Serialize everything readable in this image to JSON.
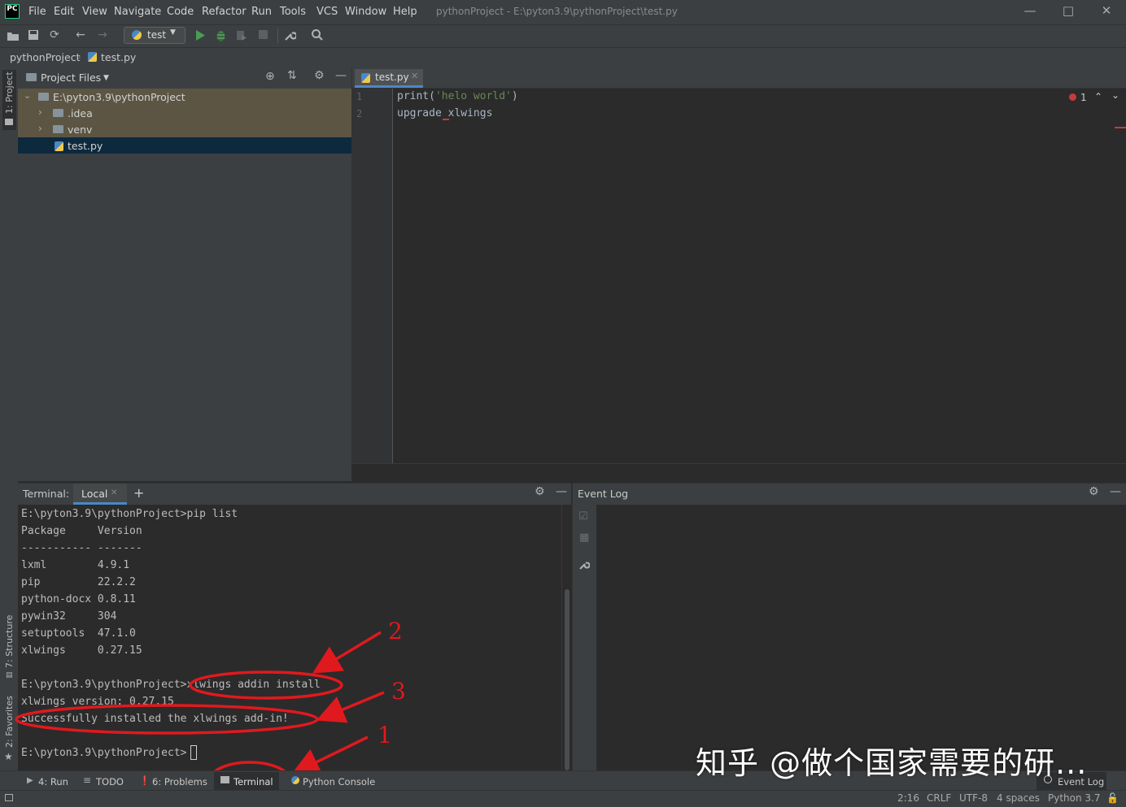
{
  "app": {
    "logo": "PC",
    "menu": [
      "File",
      "Edit",
      "View",
      "Navigate",
      "Code",
      "Refactor",
      "Run",
      "Tools",
      "VCS",
      "Window",
      "Help"
    ],
    "window_title": "pythonProject - E:\\pyton3.9\\pythonProject\\test.py"
  },
  "toolbar": {
    "run_config": "test"
  },
  "breadcrumb": [
    "pythonProject",
    "test.py"
  ],
  "left_stripe": {
    "project_tab": "1: Project",
    "structure_tab": "7: Structure",
    "favorites_tab": "2: Favorites"
  },
  "project": {
    "view_selector": "Project Files",
    "tree": [
      {
        "label": "E:\\pyton3.9\\pythonProject",
        "type": "folder",
        "expanded": true
      },
      {
        "label": ".idea",
        "type": "folder",
        "expanded": false
      },
      {
        "label": "venv",
        "type": "folder",
        "expanded": false
      },
      {
        "label": "test.py",
        "type": "python-file",
        "selected": true
      }
    ]
  },
  "editor": {
    "tab": "test.py",
    "error_count": "1",
    "lines": [
      {
        "no": "1",
        "code_fn": "print(",
        "code_str": "'helo world'",
        "code_end": ")"
      },
      {
        "no": "2",
        "code": "upgrade xlwings"
      }
    ]
  },
  "terminal": {
    "header_label": "Terminal:",
    "tab": "Local",
    "lines": [
      "E:\\pyton3.9\\pythonProject>pip list",
      "Package     Version",
      "----------- -------",
      "lxml        4.9.1",
      "pip         22.2.2",
      "python-docx 0.8.11",
      "pywin32     304",
      "setuptools  47.1.0",
      "xlwings     0.27.15",
      "",
      "E:\\pyton3.9\\pythonProject>xlwings addin install",
      "xlwings version: 0.27.15",
      "Successfully installed the xlwings add-in!",
      "",
      "E:\\pyton3.9\\pythonProject>"
    ]
  },
  "event_log": {
    "title": "Event Log"
  },
  "annotations": {
    "one": "1",
    "two": "2",
    "three": "3"
  },
  "tool_windows": {
    "run": "4: Run",
    "todo": "TODO",
    "problems": "6: Problems",
    "terminal": "Terminal",
    "python_console": "Python Console",
    "event_log": "Event Log"
  },
  "status": {
    "position": "2:16",
    "line_sep": "CRLF",
    "encoding": "UTF-8",
    "indent": "4 spaces",
    "interpreter": "Python 3.7"
  },
  "watermark": "知乎 @做个国家需要的研...",
  "colors": {
    "accent": "#4a88c7",
    "annotation_red": "#e0191e",
    "run_green": "#499c54",
    "selection": "#0d293e"
  }
}
